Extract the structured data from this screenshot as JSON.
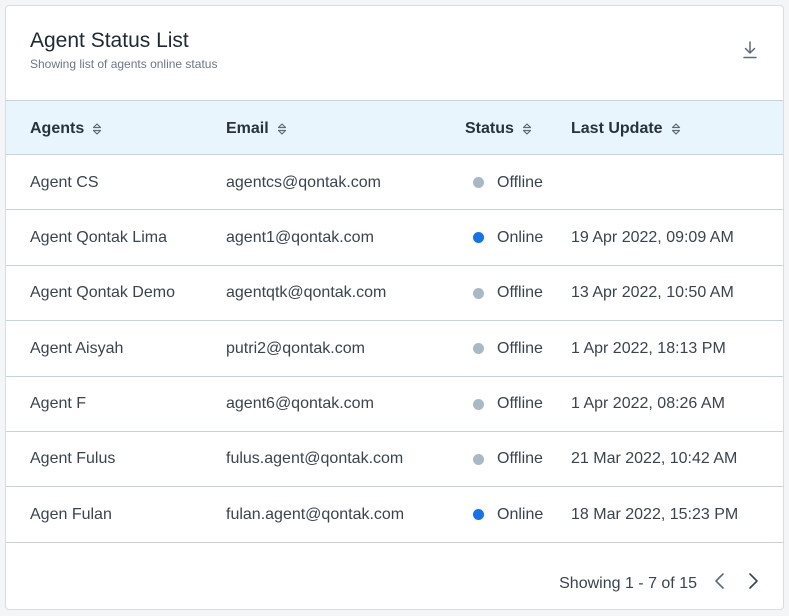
{
  "header": {
    "title": "Agent Status List",
    "subtitle": "Showing list of agents online status",
    "download_icon": "download-icon"
  },
  "table": {
    "columns": [
      "Agents",
      "Email",
      "Status",
      "Last Update"
    ],
    "rows": [
      {
        "agent": "Agent CS",
        "email": "agentcs@qontak.com",
        "status": "Offline",
        "last_update": ""
      },
      {
        "agent": "Agent Qontak Lima",
        "email": "agent1@qontak.com",
        "status": "Online",
        "last_update": "19 Apr 2022, 09:09 AM"
      },
      {
        "agent": "Agent Qontak Demo",
        "email": "agentqtk@qontak.com",
        "status": "Offline",
        "last_update": "13 Apr 2022, 10:50 AM"
      },
      {
        "agent": "Agent Aisyah",
        "email": "putri2@qontak.com",
        "status": "Offline",
        "last_update": "1 Apr 2022, 18:13 PM"
      },
      {
        "agent": "Agent F",
        "email": "agent6@qontak.com",
        "status": "Offline",
        "last_update": "1 Apr 2022, 08:26 AM"
      },
      {
        "agent": "Agent Fulus",
        "email": "fulus.agent@qontak.com",
        "status": "Offline",
        "last_update": "21 Mar 2022, 10:42 AM"
      },
      {
        "agent": "Agen Fulan",
        "email": "fulan.agent@qontak.com",
        "status": "Online",
        "last_update": "18 Mar 2022, 15:23 PM"
      }
    ]
  },
  "pagination": {
    "text": "Showing 1 - 7 of 15"
  },
  "colors": {
    "online": "#1472f0",
    "offline": "#a9b9c3",
    "header_bg": "#e8f5fd"
  }
}
